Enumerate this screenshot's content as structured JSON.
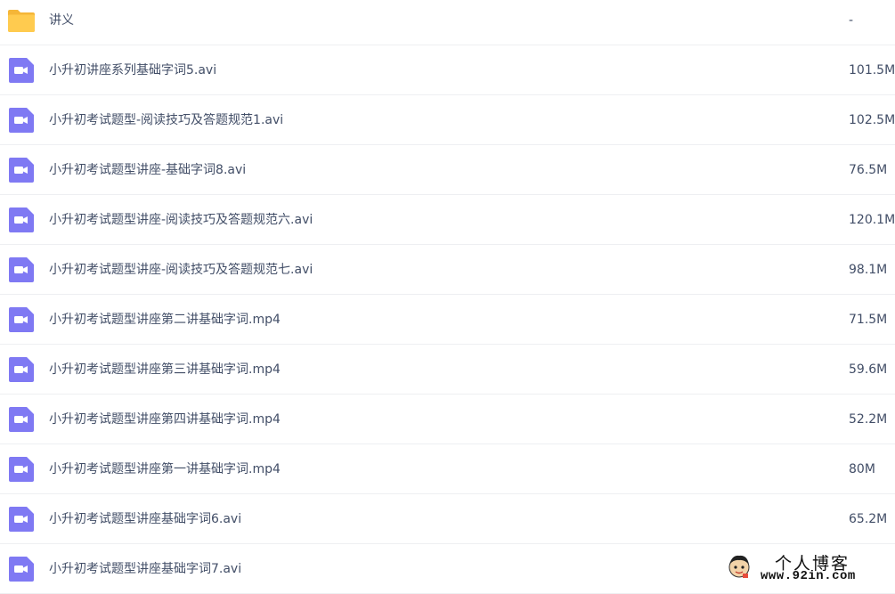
{
  "files": [
    {
      "name": "讲义",
      "size": "-",
      "icon": "folder-icon",
      "type": "folder"
    },
    {
      "name": "小升初讲座系列基础字词5.avi",
      "size": "101.5M",
      "icon": "video-file-icon",
      "type": "video"
    },
    {
      "name": "小升初考试题型-阅读技巧及答题规范1.avi",
      "size": "102.5M",
      "icon": "video-file-icon",
      "type": "video"
    },
    {
      "name": "小升初考试题型讲座-基础字词8.avi",
      "size": "76.5M",
      "icon": "video-file-icon",
      "type": "video"
    },
    {
      "name": "小升初考试题型讲座-阅读技巧及答题规范六.avi",
      "size": "120.1M",
      "icon": "video-file-icon",
      "type": "video"
    },
    {
      "name": "小升初考试题型讲座-阅读技巧及答题规范七.avi",
      "size": "98.1M",
      "icon": "video-file-icon",
      "type": "video"
    },
    {
      "name": "小升初考试题型讲座第二讲基础字词.mp4",
      "size": "71.5M",
      "icon": "video-file-icon",
      "type": "video"
    },
    {
      "name": "小升初考试题型讲座第三讲基础字词.mp4",
      "size": "59.6M",
      "icon": "video-file-icon",
      "type": "video"
    },
    {
      "name": "小升初考试题型讲座第四讲基础字词.mp4",
      "size": "52.2M",
      "icon": "video-file-icon",
      "type": "video"
    },
    {
      "name": "小升初考试题型讲座第一讲基础字词.mp4",
      "size": "80M",
      "icon": "video-file-icon",
      "type": "video"
    },
    {
      "name": "小升初考试题型讲座基础字词6.avi",
      "size": "65.2M",
      "icon": "video-file-icon",
      "type": "video"
    },
    {
      "name": "小升初考试题型讲座基础字词7.avi",
      "size": "",
      "icon": "video-file-icon",
      "type": "video"
    }
  ],
  "watermark": {
    "title": "个人博客",
    "url": "www.92in.com"
  },
  "colors": {
    "folder": "#ffcb4f",
    "folder_tab": "#f5b638",
    "video": "#7f79f3",
    "text": "#424e67",
    "divider": "#eeeff2"
  }
}
